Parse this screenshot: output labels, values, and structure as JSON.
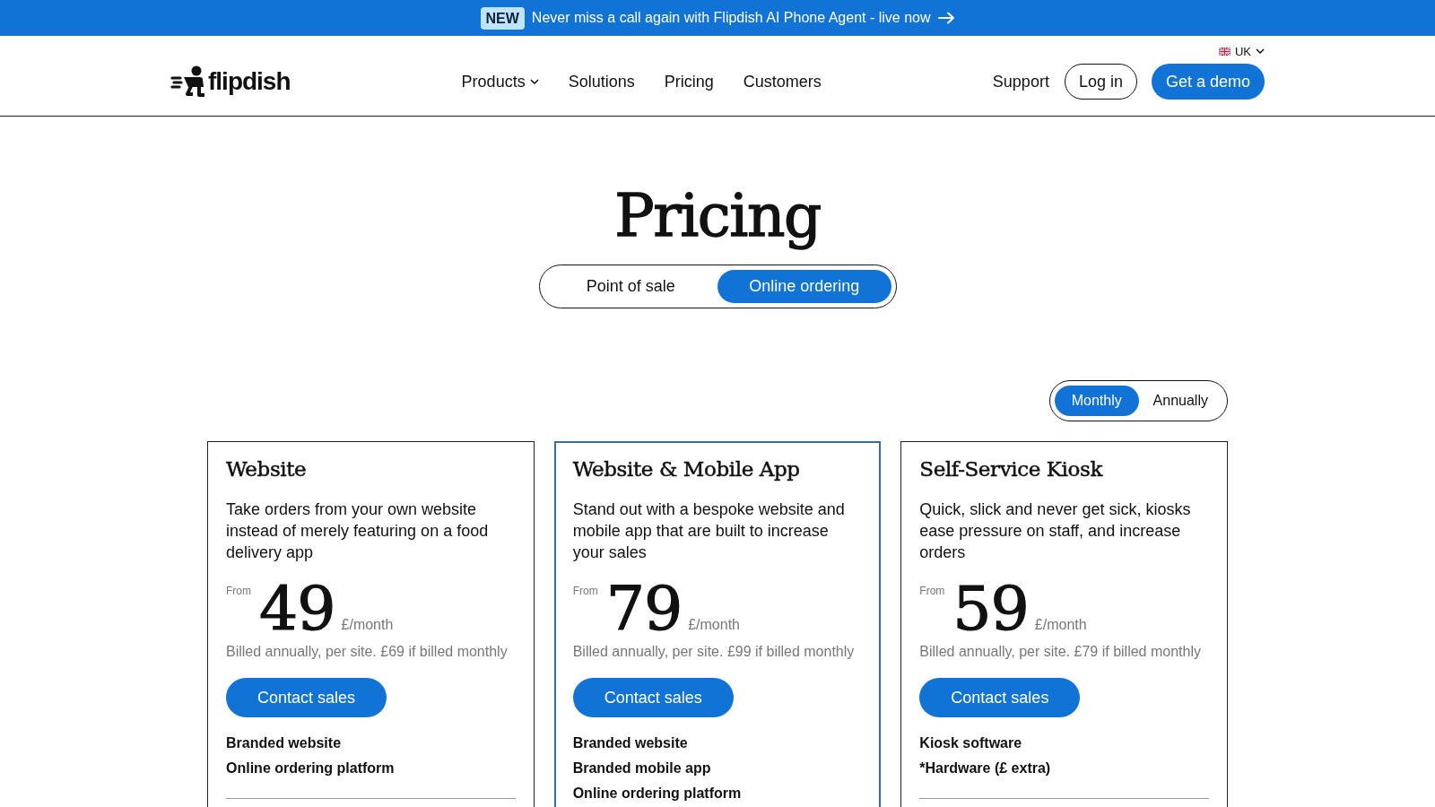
{
  "announcement": {
    "badge": "NEW",
    "text": "Never miss a call again with Flipdish AI Phone Agent - live now"
  },
  "header": {
    "region": "UK",
    "logo": "flipdish",
    "nav": [
      {
        "label": "Products",
        "has_menu": true
      },
      {
        "label": "Solutions",
        "has_menu": false
      },
      {
        "label": "Pricing",
        "has_menu": false
      },
      {
        "label": "Customers",
        "has_menu": false
      }
    ],
    "support": "Support",
    "login": "Log in",
    "demo": "Get a demo"
  },
  "hero": {
    "title": "Pricing",
    "product_tabs": [
      {
        "label": "Point of sale",
        "selected": false
      },
      {
        "label": "Online ordering",
        "selected": true
      }
    ]
  },
  "billing_tabs": [
    {
      "label": "Monthly",
      "selected": true
    },
    {
      "label": "Annually",
      "selected": false
    }
  ],
  "plans": [
    {
      "title": "Website",
      "description": "Take orders from your own website instead of merely featuring on a food delivery app",
      "price_prefix": "From",
      "price": "49",
      "price_unit": "£/month",
      "note": "Billed annually, per site. £69 if billed monthly",
      "button": "Contact sales",
      "highlighted": false,
      "features": [
        "Branded website",
        "Online ordering platform"
      ]
    },
    {
      "title": "Website & Mobile App",
      "description": "Stand out with a bespoke website and mobile app that are built to increase your sales",
      "price_prefix": "From",
      "price": "79",
      "price_unit": "£/month",
      "note": "Billed annually, per site. £99 if billed monthly",
      "button": "Contact sales",
      "highlighted": true,
      "features": [
        "Branded website",
        "Branded mobile app",
        "Online ordering platform"
      ]
    },
    {
      "title": "Self-Service Kiosk",
      "description": "Quick, slick and never get sick, kiosks ease pressure on staff, and increase orders",
      "price_prefix": "From",
      "price": "59",
      "price_unit": "£/month",
      "note": "Billed annually, per site. £79 if billed monthly",
      "button": "Contact sales",
      "highlighted": false,
      "features": [
        "Kiosk software",
        "*Hardware (£ extra)"
      ]
    }
  ]
}
